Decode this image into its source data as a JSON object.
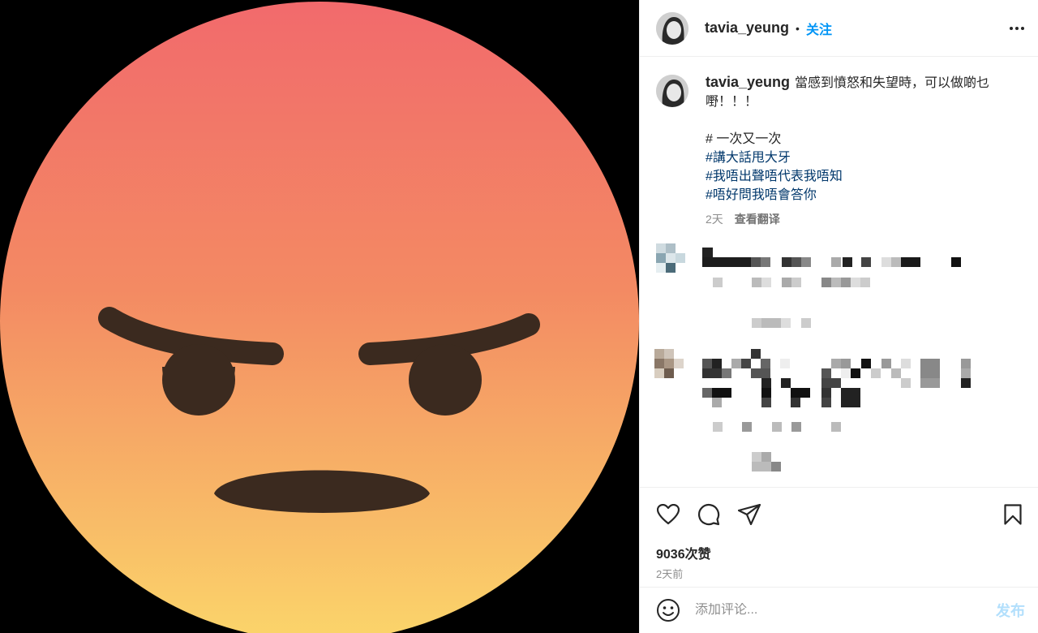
{
  "post": {
    "username": "tavia_yeung",
    "separator": "•",
    "follow_label": "关注",
    "more_icon": "more-horizontal-icon"
  },
  "caption": {
    "username": "tavia_yeung",
    "text": "當感到憤怒和失望時，可以做啲乜嘢！！！",
    "tag_plain": "# 一次又一次",
    "tags": [
      "#講大話甩大牙",
      "#我唔出聲唔代表我唔知",
      "#唔好問我唔會答你"
    ],
    "time": "2天",
    "translate_label": "查看翻译"
  },
  "actions": {
    "like_icon": "heart-icon",
    "comment_icon": "comment-icon",
    "share_icon": "send-icon",
    "save_icon": "bookmark-icon"
  },
  "likes": "9036次赞",
  "posted_ago": "2天前",
  "comment_box": {
    "emoji_icon": "emoji-icon",
    "placeholder": "添加评论...",
    "post_label": "发布"
  },
  "colors": {
    "follow": "#0095f6",
    "hashtag": "#00376b",
    "post_disabled": "#b2dffc",
    "emoji_top": "#f26b6b",
    "emoji_bottom": "#fbd46a"
  }
}
